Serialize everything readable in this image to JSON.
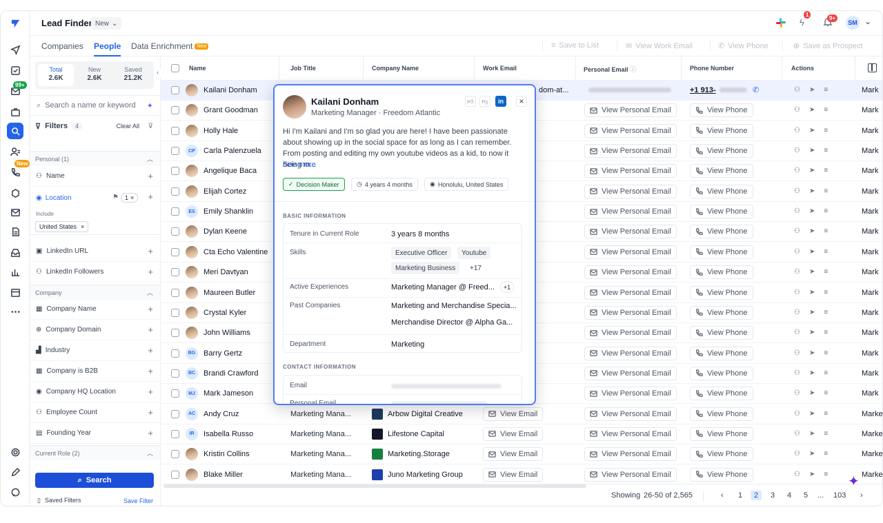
{
  "app": {
    "title": "Lead Finder",
    "title_pill": "New",
    "notif_badge_1": "1",
    "notif_badge_2": "9+",
    "user_initials": "SM",
    "rail_badge_1": "99+",
    "rail_badge_2": "New"
  },
  "tabs": [
    {
      "label": "Companies"
    },
    {
      "label": "People"
    },
    {
      "label": "Data Enrichment",
      "tag": "New"
    }
  ],
  "toolbar": {
    "save_to_list": "Save to List",
    "view_work_email": "View Work Email",
    "view_phone": "View Phone",
    "save_as_prospect": "Save as Prospect"
  },
  "filters": {
    "stats": [
      {
        "label": "Total",
        "value": "2.6K"
      },
      {
        "label": "New",
        "value": "2.6K"
      },
      {
        "label": "Saved",
        "value": "21.2K"
      }
    ],
    "search_placeholder": "Search a name or keyword",
    "title": "Filters",
    "count": "4",
    "clear_all": "Clear All",
    "personal_header": "Personal (1)",
    "name": "Name",
    "location": "Location",
    "location_count": "1",
    "include": "Include",
    "location_value": "United States",
    "linkedin_url": "LinkedIn URL",
    "linkedin_followers": "LinkedIn Followers",
    "company_header": "Company",
    "company_items": [
      "Company Name",
      "Company Domain",
      "Industry",
      "Company is B2B",
      "Company HQ Location",
      "Employee Count",
      "Founding Year"
    ],
    "role_header": "Current Role (2)",
    "search_button": "Search",
    "saved_filters": "Saved Filters",
    "save_filter": "Save Filter"
  },
  "table": {
    "headers": [
      "Name",
      "Job Title",
      "Company Name",
      "Work Email",
      "Personal Email",
      "Phone Number",
      "Actions"
    ],
    "view_personal_email": "View Personal Email",
    "view_phone": "View Phone",
    "view_email": "View Email",
    "first_row_phone": "+1 913-",
    "first_row_work_email": "dom-at...",
    "rows": [
      {
        "name": "Kailani Donham",
        "initials": "",
        "owner": "Mark"
      },
      {
        "name": "Grant Goodman",
        "initials": "",
        "owner": "Mark"
      },
      {
        "name": "Holly Hale",
        "initials": "",
        "owner": "Mark"
      },
      {
        "name": "Carla Palenzuela",
        "initials": "CP",
        "owner": "Mark"
      },
      {
        "name": "Angelique Baca",
        "initials": "",
        "owner": "Mark"
      },
      {
        "name": "Elijah Cortez",
        "initials": "",
        "owner": "Mark"
      },
      {
        "name": "Emily Shanklin",
        "initials": "ES",
        "owner": "Mark"
      },
      {
        "name": "Dylan Keene",
        "initials": "",
        "owner": "Mark"
      },
      {
        "name": "Cta Echo Valentine",
        "initials": "",
        "owner": "Mark"
      },
      {
        "name": "Meri Davtyan",
        "initials": "",
        "owner": "Mark"
      },
      {
        "name": "Maureen Butler",
        "initials": "",
        "owner": "Mark"
      },
      {
        "name": "Crystal Kyler",
        "initials": "",
        "owner": "Mark"
      },
      {
        "name": "John Williams",
        "initials": "",
        "owner": "Mark"
      },
      {
        "name": "Barry Gertz",
        "initials": "BG",
        "owner": "Mark"
      },
      {
        "name": "Brandi Crawford",
        "initials": "BC",
        "owner": "Mark"
      },
      {
        "name": "Mark Jameson",
        "initials": "MJ",
        "owner": "Mark"
      },
      {
        "name": "Andy Cruz",
        "initials": "AC",
        "owner": "Marke",
        "job": "Marketing Mana...",
        "company": "Arbow Digital Creative"
      },
      {
        "name": "Isabella Russo",
        "initials": "IR",
        "owner": "Marke",
        "job": "Marketing Mana...",
        "company": "Lifestone Capital"
      },
      {
        "name": "Kristin Collins",
        "initials": "",
        "owner": "Marke",
        "job": "Marketing Mana...",
        "company": "Marketing.Storage"
      },
      {
        "name": "Blake Miller",
        "initials": "",
        "owner": "Marke",
        "job": "Marketing Mana...",
        "company": "Juno Marketing Group"
      }
    ]
  },
  "pagination": {
    "showing_label": "Showing",
    "range": "26-50 of 2,565",
    "pages": [
      "1",
      "2",
      "3",
      "4",
      "5",
      "...",
      "103"
    ],
    "current": "2"
  },
  "popup": {
    "name": "Kailani Donham",
    "subtitle": "Marketing Manager · Freedom Atlantic",
    "bio": "Hi I'm Kailani and I'm so glad you are here! I have been passionate about showing up in the social space for as long as I can remember. From posting and editing my own youtube videos as a kid, to now it being m...",
    "see_more": "See more",
    "chips": [
      "Decision Maker",
      "4 years 4 months",
      "Honolulu, United States"
    ],
    "basic_header": "BASIC INFORMATION",
    "tenure_label": "Tenure in Current Role",
    "tenure_value": "3 years 8 months",
    "skills_label": "Skills",
    "skills": [
      "Executive Officer",
      "Youtube",
      "Marketing Business",
      "+17"
    ],
    "active_exp_label": "Active Experiences",
    "active_exp_value": "Marketing Manager @ Freed...",
    "active_exp_more": "+1",
    "past_label": "Past Companies",
    "past_values": [
      "Marketing and Merchandise Specia...",
      "Merchandise Director @ Alpha Ga..."
    ],
    "dept_label": "Department",
    "dept_value": "Marketing",
    "contact_header": "CONTACT INFORMATION",
    "email_label": "Email",
    "personal_email_label": "Personal Email"
  }
}
